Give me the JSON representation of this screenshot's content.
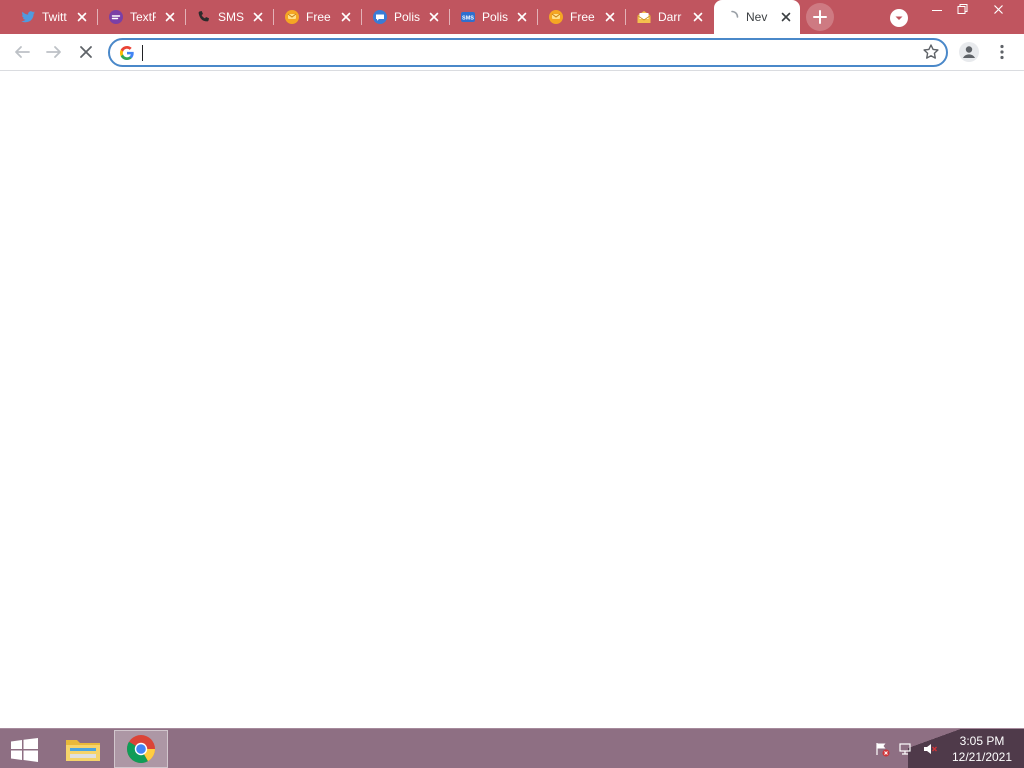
{
  "browser": {
    "tabs": [
      {
        "title": "Twitt",
        "icon": "twitter-bird-icon",
        "active": false
      },
      {
        "title": "TextF",
        "icon": "textfree-icon",
        "active": false
      },
      {
        "title": "SMS",
        "icon": "phone-icon",
        "active": false
      },
      {
        "title": "Free",
        "icon": "emoji-message-icon",
        "active": false
      },
      {
        "title": "Polis",
        "icon": "chat-bubble-icon",
        "active": false
      },
      {
        "title": "Polis",
        "icon": "sms-icon",
        "active": false
      },
      {
        "title": "Free",
        "icon": "emoji-message-icon",
        "active": false
      },
      {
        "title": "Darr",
        "icon": "envelope-icon",
        "active": false
      },
      {
        "title": "Nev",
        "icon": "loading-spinner-icon",
        "active": true
      }
    ],
    "new_tab_label": "+",
    "address": {
      "value": "",
      "placeholder": ""
    },
    "colors": {
      "frame": "#c0555f",
      "omnibox_focus": "#4a88c9"
    }
  },
  "taskbar": {
    "apps": [
      {
        "name": "File Explorer",
        "icon": "folder-icon",
        "active": false
      },
      {
        "name": "Google Chrome",
        "icon": "chrome-icon",
        "active": true
      }
    ],
    "tray": {
      "time": "3:05 PM",
      "date": "12/21/2021"
    },
    "color": "#8e6f83"
  }
}
